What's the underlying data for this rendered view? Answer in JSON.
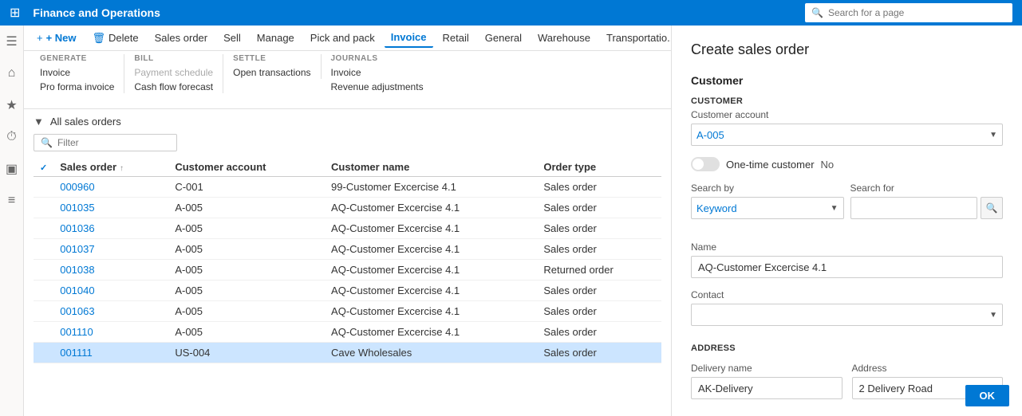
{
  "app": {
    "title": "Finance and Operations",
    "search_placeholder": "Search for a page"
  },
  "top_nav_icons": [
    "⊞",
    "☰",
    "⌂",
    "★",
    "⏱",
    "▣",
    "☰"
  ],
  "toolbar": {
    "new_label": "+ New",
    "delete_label": "Delete",
    "sales_order_label": "Sales order",
    "sell_label": "Sell",
    "manage_label": "Manage",
    "pick_and_pack_label": "Pick and pack",
    "invoice_label": "Invoice",
    "retail_label": "Retail",
    "general_label": "General",
    "warehouse_label": "Warehouse",
    "transportation_label": "Transportatio..."
  },
  "ribbon": {
    "groups": [
      {
        "label": "GENERATE",
        "items": [
          {
            "label": "Invoice",
            "disabled": false
          },
          {
            "label": "Pro forma invoice",
            "disabled": false
          }
        ]
      },
      {
        "label": "BILL",
        "items": [
          {
            "label": "Payment schedule",
            "disabled": true
          },
          {
            "label": "Cash flow forecast",
            "disabled": false
          }
        ]
      },
      {
        "label": "SETTLE",
        "items": [
          {
            "label": "Open transactions",
            "disabled": false
          }
        ]
      },
      {
        "label": "JOURNALS",
        "items": [
          {
            "label": "Invoice",
            "disabled": false
          },
          {
            "label": "Revenue adjustments",
            "disabled": false
          }
        ]
      }
    ]
  },
  "table": {
    "title": "All sales orders",
    "filter_placeholder": "Filter",
    "columns": [
      "Sales order",
      "Customer account",
      "Customer name",
      "Order type"
    ],
    "rows": [
      {
        "sales_order": "000960",
        "customer_account": "C-001",
        "customer_name": "99-Customer Excercise 4.1",
        "order_type": "Sales order",
        "selected": false,
        "link": true
      },
      {
        "sales_order": "001035",
        "customer_account": "A-005",
        "customer_name": "AQ-Customer Excercise 4.1",
        "order_type": "Sales order",
        "selected": false,
        "link": true
      },
      {
        "sales_order": "001036",
        "customer_account": "A-005",
        "customer_name": "AQ-Customer Excercise 4.1",
        "order_type": "Sales order",
        "selected": false,
        "link": true
      },
      {
        "sales_order": "001037",
        "customer_account": "A-005",
        "customer_name": "AQ-Customer Excercise 4.1",
        "order_type": "Sales order",
        "selected": false,
        "link": true
      },
      {
        "sales_order": "001038",
        "customer_account": "A-005",
        "customer_name": "AQ-Customer Excercise 4.1",
        "order_type": "Returned order",
        "selected": false,
        "link": true
      },
      {
        "sales_order": "001040",
        "customer_account": "A-005",
        "customer_name": "AQ-Customer Excercise 4.1",
        "order_type": "Sales order",
        "selected": false,
        "link": true
      },
      {
        "sales_order": "001063",
        "customer_account": "A-005",
        "customer_name": "AQ-Customer Excercise 4.1",
        "order_type": "Sales order",
        "selected": false,
        "link": true
      },
      {
        "sales_order": "001110",
        "customer_account": "A-005",
        "customer_name": "AQ-Customer Excercise 4.1",
        "order_type": "Sales order",
        "selected": false,
        "link": true
      },
      {
        "sales_order": "001111",
        "customer_account": "US-004",
        "customer_name": "Cave Wholesales",
        "order_type": "Sales order",
        "selected": true,
        "link": true
      }
    ]
  },
  "create_panel": {
    "title": "Create sales order",
    "section_customer": "Customer",
    "section_label_customer": "CUSTOMER",
    "customer_account_label": "Customer account",
    "customer_account_value": "A-005",
    "one_time_customer_label": "One-time customer",
    "one_time_customer_toggle": false,
    "one_time_customer_value": "No",
    "search_by_label": "Search by",
    "search_by_value": "Keyword",
    "search_for_label": "Search for",
    "search_for_value": "",
    "name_label": "Name",
    "name_value": "AQ-Customer Excercise 4.1",
    "contact_label": "Contact",
    "contact_value": "",
    "section_address": "ADDRESS",
    "delivery_name_label": "Delivery name",
    "delivery_name_value": "AK-Delivery",
    "address_label": "Address",
    "address_value": "2 Delivery Road",
    "address_line2": "...",
    "ok_label": "OK"
  }
}
